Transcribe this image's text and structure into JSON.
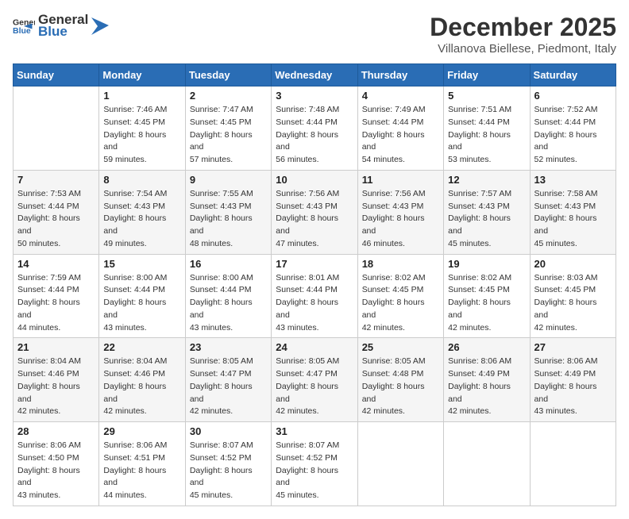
{
  "header": {
    "logo_general": "General",
    "logo_blue": "Blue",
    "month_title": "December 2025",
    "location": "Villanova Biellese, Piedmont, Italy"
  },
  "weekdays": [
    "Sunday",
    "Monday",
    "Tuesday",
    "Wednesday",
    "Thursday",
    "Friday",
    "Saturday"
  ],
  "weeks": [
    [
      {
        "day": null,
        "info": null
      },
      {
        "day": "1",
        "sunrise": "7:46 AM",
        "sunset": "4:45 PM",
        "daylight": "8 hours and 59 minutes."
      },
      {
        "day": "2",
        "sunrise": "7:47 AM",
        "sunset": "4:45 PM",
        "daylight": "8 hours and 57 minutes."
      },
      {
        "day": "3",
        "sunrise": "7:48 AM",
        "sunset": "4:44 PM",
        "daylight": "8 hours and 56 minutes."
      },
      {
        "day": "4",
        "sunrise": "7:49 AM",
        "sunset": "4:44 PM",
        "daylight": "8 hours and 54 minutes."
      },
      {
        "day": "5",
        "sunrise": "7:51 AM",
        "sunset": "4:44 PM",
        "daylight": "8 hours and 53 minutes."
      },
      {
        "day": "6",
        "sunrise": "7:52 AM",
        "sunset": "4:44 PM",
        "daylight": "8 hours and 52 minutes."
      }
    ],
    [
      {
        "day": "7",
        "sunrise": "7:53 AM",
        "sunset": "4:44 PM",
        "daylight": "8 hours and 50 minutes."
      },
      {
        "day": "8",
        "sunrise": "7:54 AM",
        "sunset": "4:43 PM",
        "daylight": "8 hours and 49 minutes."
      },
      {
        "day": "9",
        "sunrise": "7:55 AM",
        "sunset": "4:43 PM",
        "daylight": "8 hours and 48 minutes."
      },
      {
        "day": "10",
        "sunrise": "7:56 AM",
        "sunset": "4:43 PM",
        "daylight": "8 hours and 47 minutes."
      },
      {
        "day": "11",
        "sunrise": "7:56 AM",
        "sunset": "4:43 PM",
        "daylight": "8 hours and 46 minutes."
      },
      {
        "day": "12",
        "sunrise": "7:57 AM",
        "sunset": "4:43 PM",
        "daylight": "8 hours and 45 minutes."
      },
      {
        "day": "13",
        "sunrise": "7:58 AM",
        "sunset": "4:43 PM",
        "daylight": "8 hours and 45 minutes."
      }
    ],
    [
      {
        "day": "14",
        "sunrise": "7:59 AM",
        "sunset": "4:44 PM",
        "daylight": "8 hours and 44 minutes."
      },
      {
        "day": "15",
        "sunrise": "8:00 AM",
        "sunset": "4:44 PM",
        "daylight": "8 hours and 43 minutes."
      },
      {
        "day": "16",
        "sunrise": "8:00 AM",
        "sunset": "4:44 PM",
        "daylight": "8 hours and 43 minutes."
      },
      {
        "day": "17",
        "sunrise": "8:01 AM",
        "sunset": "4:44 PM",
        "daylight": "8 hours and 43 minutes."
      },
      {
        "day": "18",
        "sunrise": "8:02 AM",
        "sunset": "4:45 PM",
        "daylight": "8 hours and 42 minutes."
      },
      {
        "day": "19",
        "sunrise": "8:02 AM",
        "sunset": "4:45 PM",
        "daylight": "8 hours and 42 minutes."
      },
      {
        "day": "20",
        "sunrise": "8:03 AM",
        "sunset": "4:45 PM",
        "daylight": "8 hours and 42 minutes."
      }
    ],
    [
      {
        "day": "21",
        "sunrise": "8:04 AM",
        "sunset": "4:46 PM",
        "daylight": "8 hours and 42 minutes."
      },
      {
        "day": "22",
        "sunrise": "8:04 AM",
        "sunset": "4:46 PM",
        "daylight": "8 hours and 42 minutes."
      },
      {
        "day": "23",
        "sunrise": "8:05 AM",
        "sunset": "4:47 PM",
        "daylight": "8 hours and 42 minutes."
      },
      {
        "day": "24",
        "sunrise": "8:05 AM",
        "sunset": "4:47 PM",
        "daylight": "8 hours and 42 minutes."
      },
      {
        "day": "25",
        "sunrise": "8:05 AM",
        "sunset": "4:48 PM",
        "daylight": "8 hours and 42 minutes."
      },
      {
        "day": "26",
        "sunrise": "8:06 AM",
        "sunset": "4:49 PM",
        "daylight": "8 hours and 42 minutes."
      },
      {
        "day": "27",
        "sunrise": "8:06 AM",
        "sunset": "4:49 PM",
        "daylight": "8 hours and 43 minutes."
      }
    ],
    [
      {
        "day": "28",
        "sunrise": "8:06 AM",
        "sunset": "4:50 PM",
        "daylight": "8 hours and 43 minutes."
      },
      {
        "day": "29",
        "sunrise": "8:06 AM",
        "sunset": "4:51 PM",
        "daylight": "8 hours and 44 minutes."
      },
      {
        "day": "30",
        "sunrise": "8:07 AM",
        "sunset": "4:52 PM",
        "daylight": "8 hours and 45 minutes."
      },
      {
        "day": "31",
        "sunrise": "8:07 AM",
        "sunset": "4:52 PM",
        "daylight": "8 hours and 45 minutes."
      },
      {
        "day": null,
        "info": null
      },
      {
        "day": null,
        "info": null
      },
      {
        "day": null,
        "info": null
      }
    ]
  ]
}
